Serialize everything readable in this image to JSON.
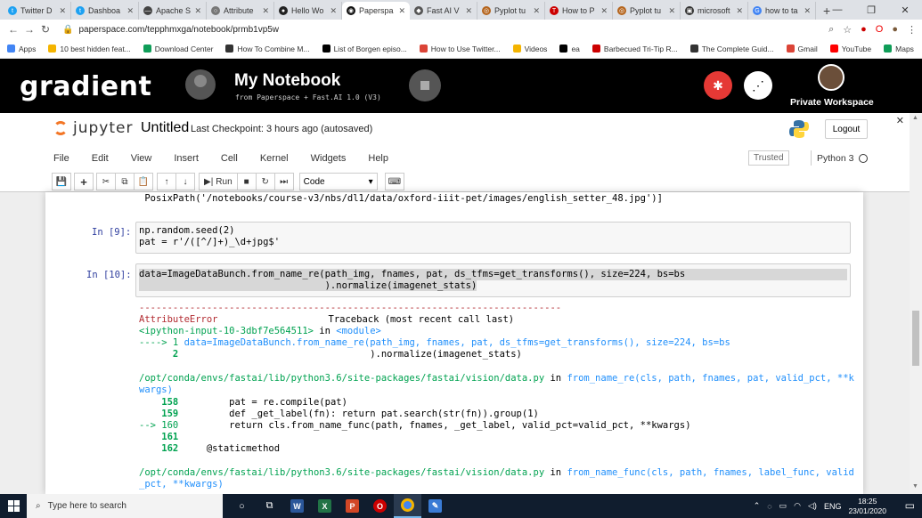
{
  "browser": {
    "tabs": [
      {
        "label": "Twitter D",
        "color": "#1da1f2",
        "glyph": "t"
      },
      {
        "label": "Dashboa",
        "color": "#1da1f2",
        "glyph": "t"
      },
      {
        "label": "Apache S",
        "color": "#444",
        "glyph": "—"
      },
      {
        "label": "Attribute",
        "color": "#777",
        "glyph": "○"
      },
      {
        "label": "Hello Wo",
        "color": "#222",
        "glyph": "●"
      },
      {
        "label": "Paperspa",
        "color": "#111",
        "glyph": "◉",
        "active": true
      },
      {
        "label": "Fast AI V",
        "color": "#555",
        "glyph": "◆"
      },
      {
        "label": "Pyplot tu",
        "color": "#b5651d",
        "glyph": "◎"
      },
      {
        "label": "How to P",
        "color": "#c00",
        "glyph": "T"
      },
      {
        "label": "Pyplot tu",
        "color": "#b5651d",
        "glyph": "◎"
      },
      {
        "label": "microsoft",
        "color": "#333",
        "glyph": "▣"
      },
      {
        "label": "how to ta",
        "color": "#4285f4",
        "glyph": "G"
      }
    ],
    "new_tab": "+",
    "url": "paperspace.com/tepphmxga/notebook/prmb1vp5w",
    "bookmarks": [
      {
        "label": "Apps",
        "color": "#4285f4"
      },
      {
        "label": "10 best hidden feat...",
        "color": "#f4b400"
      },
      {
        "label": "Download Center",
        "color": "#0f9d58"
      },
      {
        "label": "How To Combine M...",
        "color": "#333"
      },
      {
        "label": "List of Borgen episo...",
        "color": "#000"
      },
      {
        "label": "How to Use Twitter...",
        "color": "#db4437"
      },
      {
        "label": "Videos",
        "color": "#f4b400"
      },
      {
        "label": "ea",
        "color": "#000"
      },
      {
        "label": "Barbecued Tri-Tip R...",
        "color": "#c00"
      },
      {
        "label": "The Complete Guid...",
        "color": "#333"
      },
      {
        "label": "Gmail",
        "color": "#db4437"
      },
      {
        "label": "YouTube",
        "color": "#ff0000"
      },
      {
        "label": "Maps",
        "color": "#0f9d58"
      }
    ]
  },
  "gradient": {
    "logo": "gradient",
    "title": "My Notebook",
    "subtitle": "from Paperspace + Fast.AI 1.0 (V3)",
    "workspace": "Private Workspace"
  },
  "jupyter": {
    "logo_text": "jupyter",
    "notebook_name": "Untitled",
    "checkpoint": "Last Checkpoint: 3 hours ago  (autosaved)",
    "logout": "Logout",
    "menu": [
      "File",
      "Edit",
      "View",
      "Insert",
      "Cell",
      "Kernel",
      "Widgets",
      "Help"
    ],
    "trusted": "Trusted",
    "kernel": "Python 3",
    "toolbar": {
      "run": "Run",
      "cell_type": "Code"
    }
  },
  "cells": {
    "prev_output": " PosixPath('/notebooks/course-v3/nbs/dl1/data/oxford-iiit-pet/images/english_setter_48.jpg')]",
    "in9_prompt": "In [9]:",
    "in9_line1": "np.random.seed(2)",
    "in9_line2": "pat = r'/([^/]+)_\\d+jpg$'",
    "in10_prompt": "In [10]:",
    "in10_line1": "data=ImageDataBunch.from_name_re(path_img, fnames, pat, ds_tfms=get_transforms(), size=224, bs=bs",
    "in10_line2": "                                 ).normalize(imagenet_stats)",
    "tb_dashes": "---------------------------------------------------------------------------",
    "tb_error": "AttributeError",
    "tb_header": "Traceback (most recent call last)",
    "tb_input": "<ipython-input-10-3dbf7e564511>",
    "tb_in": " in ",
    "tb_module": "<module>",
    "tb_arrow1": "----> 1 ",
    "tb_line1": "data=ImageDataBunch.from_name_re(path_img, fnames, pat, ds_tfms=get_transforms(), size=224, bs=bs",
    "tb_num2": "      2 ",
    "tb_line2": "                                 ).normalize(imagenet_stats)",
    "tb_file1": "/opt/conda/envs/fastai/lib/python3.6/site-packages/fastai/vision/data.py",
    "tb_in2": " in ",
    "tb_func1": "from_name_re(cls, path, fnames, pat, valid_pct, **k",
    "tb_func1b": "wargs)",
    "src158": "    158 ",
    "src158_code": "        pat = re.compile(pat)",
    "src159": "    159 ",
    "src159_code": "        def _get_label(fn): return pat.search(str(fn)).group(1)",
    "src160": "--> 160 ",
    "src160_code": "        return cls.from_name_func(path, fnames, _get_label, valid_pct=valid_pct, **kwargs)",
    "src161": "    161 ",
    "src162": "    162 ",
    "src162_code": "    @staticmethod",
    "tb_file2": "/opt/conda/envs/fastai/lib/python3.6/site-packages/fastai/vision/data.py",
    "tb_in3": " in ",
    "tb_func2": "from_name_func(cls, path, fnames, label_func, valid",
    "tb_func2b": "_pct, **kwargs)"
  },
  "taskbar": {
    "search_placeholder": "Type here to search",
    "lang": "ENG",
    "time": "18:25",
    "date": "23/01/2020"
  }
}
